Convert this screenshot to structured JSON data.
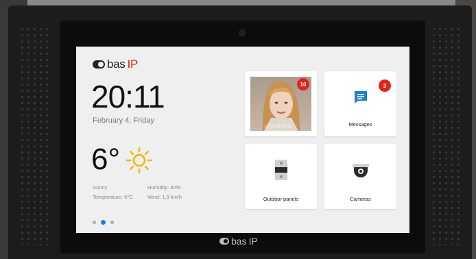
{
  "brand": {
    "prefix": "bas",
    "accent": "IP"
  },
  "clock": {
    "time": "20:11",
    "date": "February 4, Friday"
  },
  "weather": {
    "temperature": "6°",
    "condition": "Sunny",
    "temperature_line": "Temperature: 6°C",
    "humidity": "Humidity: 82%",
    "wind": "Wind: 1,9 km/h",
    "icon": "sun-icon"
  },
  "pager": {
    "count": 3,
    "active_index": 1
  },
  "tiles": {
    "visitor": {
      "badge": "10",
      "timestamp": "12.01.20 22:01"
    },
    "messages": {
      "label": "Messages",
      "badge": "3",
      "icon": "message-icon"
    },
    "outdoor": {
      "label": "Outdoor panels",
      "icon": "outdoor-panel-icon"
    },
    "cameras": {
      "label": "Cameras",
      "icon": "dome-camera-icon"
    }
  },
  "bezel_brand": {
    "prefix": "bas",
    "accent": "IP"
  },
  "colors": {
    "accent_red": "#e2231a",
    "accent_blue": "#1a7fd6",
    "sun_yellow": "#f5b400"
  }
}
